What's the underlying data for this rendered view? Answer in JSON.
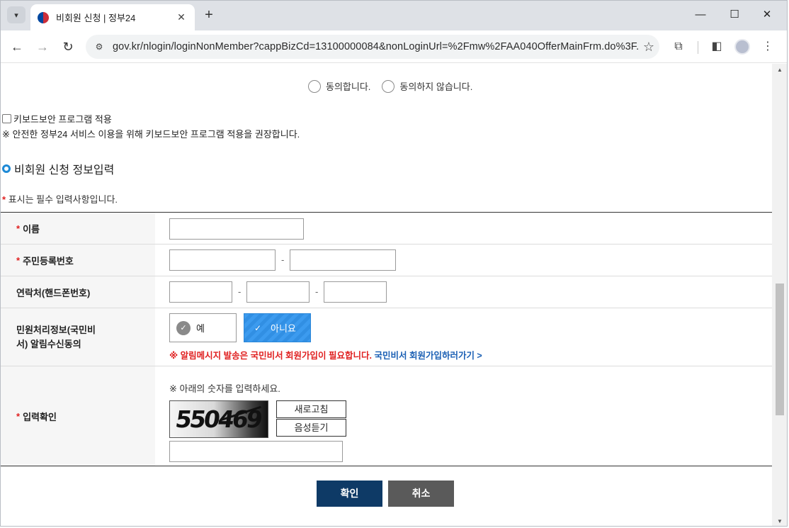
{
  "browser": {
    "tab_title": "비회원 신청 | 정부24",
    "url": "gov.kr/nlogin/loginNonMember?cappBizCd=13100000084&nonLoginUrl=%2Fmw%2FAA040OfferMainFrm.do%3F..."
  },
  "agreement": {
    "agree": "동의합니다.",
    "disagree": "동의하지 않습니다."
  },
  "keyboard_security": {
    "checkbox_label": "키보드보안 프로그램 적용",
    "note": "※ 안전한 정부24 서비스 이용을 위해 키보드보안 프로그램 적용을 권장합니다."
  },
  "section_title": "비회원 신청 정보입력",
  "required_note": {
    "star": "*",
    "text": "표시는 필수 입력사항입니다."
  },
  "form": {
    "name_label": "이름",
    "rrn_label": "주민등록번호",
    "phone_label": "연락처(핸드폰번호)",
    "notify_label": "민원처리정보(국민비서) 알림수신동의",
    "notify_yes": "예",
    "notify_no": "아니요",
    "notify_selected": "아니요",
    "notify_notice": "※  알림메시지 발송은 국민비서 회원가입이 필요합니다.",
    "notify_link": "국민비서 회원가입하러가기 >",
    "captcha_label": "입력확인",
    "captcha_note": "※ 아래의 숫자를 입력하세요.",
    "captcha_text": "550469",
    "refresh_button": "새로고침",
    "audio_button": "음성듣기",
    "dash": "-",
    "required_star": "*"
  },
  "buttons": {
    "confirm": "확인",
    "cancel": "취소"
  },
  "colors": {
    "accent_blue": "#1f8ad6",
    "confirm_navy": "#0e3a66",
    "cancel_gray": "#5a5a5a",
    "required_red": "#e02020",
    "link_blue": "#1a5fb4"
  }
}
